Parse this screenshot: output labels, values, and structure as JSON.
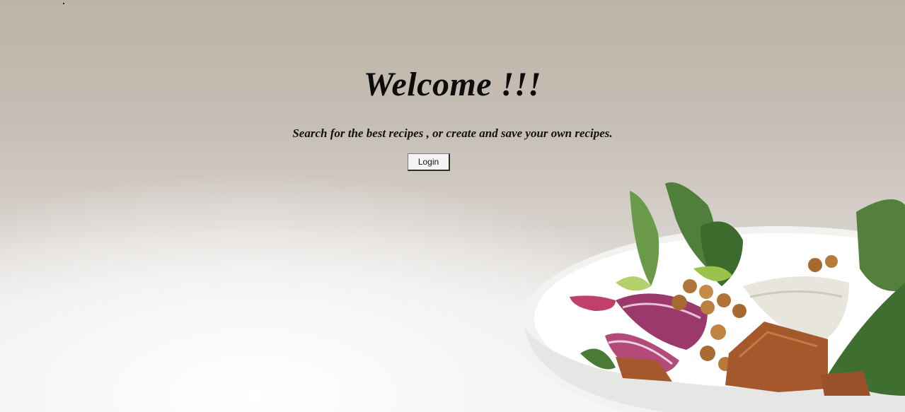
{
  "hero": {
    "title": "Welcome !!!",
    "tagline": "Search for the best recipes , or create and save your own recipes.",
    "login_label": "Login"
  },
  "colors": {
    "background_top": "#bdb3a8",
    "background_bottom": "#f6f6f6",
    "text": "#0c0c0c",
    "button_bg": "#f4f4f4"
  },
  "background_image": {
    "icon": "salad-bowl-photo"
  }
}
